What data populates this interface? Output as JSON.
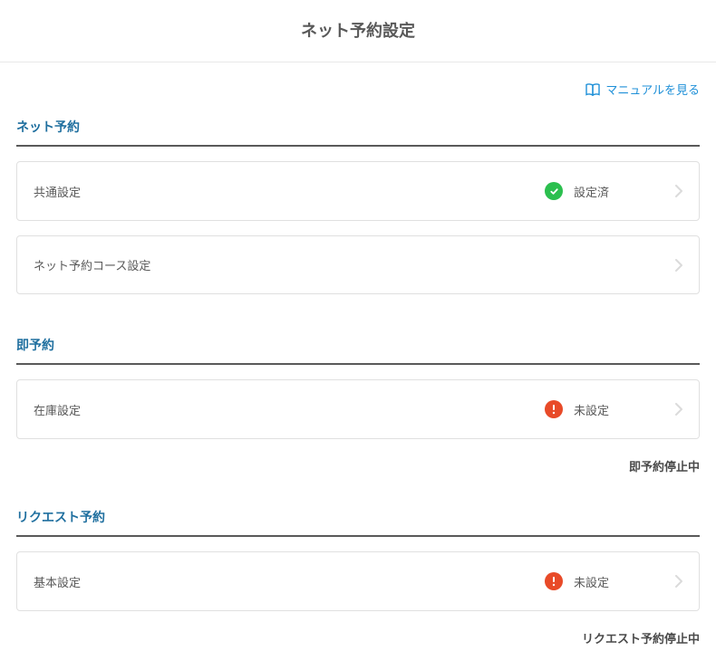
{
  "header": {
    "title": "ネット予約設定"
  },
  "manual_link": {
    "label": "マニュアルを見る"
  },
  "sections": {
    "net_reservation": {
      "title": "ネット予約",
      "items": [
        {
          "label": "共通設定",
          "status_label": "設定済",
          "status": "success"
        },
        {
          "label": "ネット予約コース設定",
          "status_label": "",
          "status": "none"
        }
      ]
    },
    "instant_reservation": {
      "title": "即予約",
      "items": [
        {
          "label": "在庫設定",
          "status_label": "未設定",
          "status": "warning"
        }
      ],
      "footer": "即予約停止中"
    },
    "request_reservation": {
      "title": "リクエスト予約",
      "items": [
        {
          "label": "基本設定",
          "status_label": "未設定",
          "status": "warning"
        }
      ],
      "footer": "リクエスト予約停止中"
    }
  }
}
